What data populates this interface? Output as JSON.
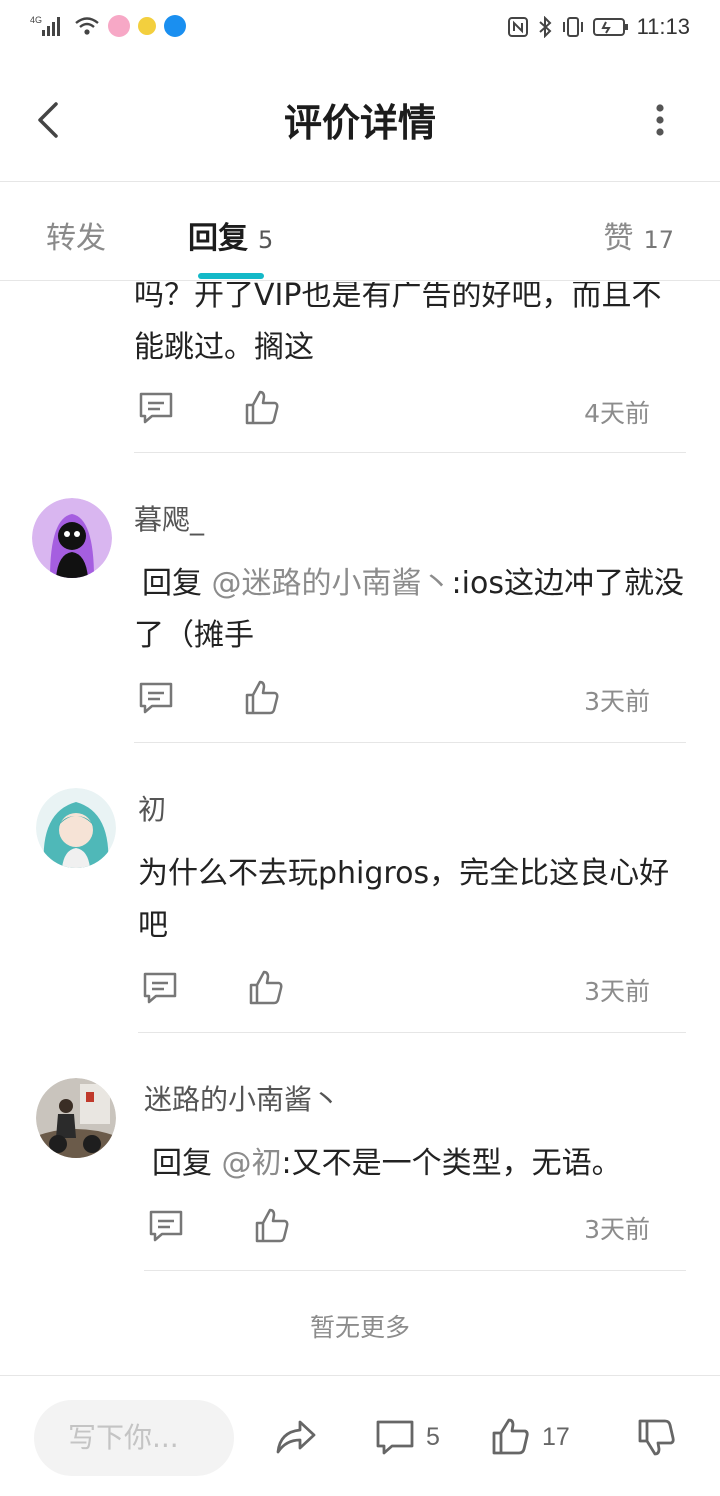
{
  "status_bar": {
    "network": "4G",
    "time": "11:13"
  },
  "header": {
    "title": "评价详情"
  },
  "tabs": [
    {
      "label": "转发",
      "count": ""
    },
    {
      "label": "回复",
      "count": "5"
    },
    {
      "label": "赞",
      "count": "17"
    }
  ],
  "replies": [
    {
      "username": "",
      "reply_prefix": "",
      "mention": "",
      "text": "吗？开了VIP也是有广告的好吧，而且不能跳过。搁这",
      "time": "4天前"
    },
    {
      "username": "暮飔_",
      "reply_prefix": "回复 ",
      "mention": "@迷路的小南酱丶",
      "text": ":ios这边冲了就没了（摊手",
      "time": "3天前"
    },
    {
      "username": "初",
      "reply_prefix": "",
      "mention": "",
      "text": "为什么不去玩phigros，完全比这良心好吧",
      "time": "3天前"
    },
    {
      "username": "迷路的小南酱丶",
      "reply_prefix": "回复 ",
      "mention": "@初",
      "text": ":又不是一个类型，无语。",
      "time": "3天前"
    }
  ],
  "footer_note": "暂无更多",
  "bottom_bar": {
    "input_placeholder": "写下你...",
    "comment_count": "5",
    "like_count": "17"
  },
  "colors": {
    "accent": "#14b9c8",
    "text_primary": "#222222",
    "text_secondary": "#8c8c8c"
  }
}
